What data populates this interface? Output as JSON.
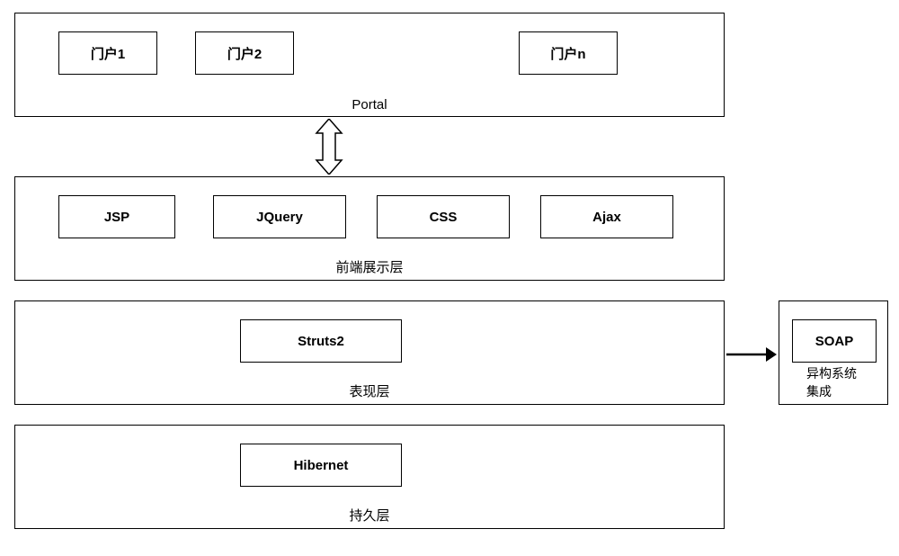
{
  "layers": {
    "portal": {
      "label": "Portal",
      "boxes": [
        "门户1",
        "门户2",
        "门户n"
      ]
    },
    "frontend": {
      "label": "前端展示层",
      "boxes": [
        "JSP",
        "JQuery",
        "CSS",
        "Ajax"
      ]
    },
    "presentation": {
      "label": "表现层",
      "boxes": [
        "Struts2"
      ]
    },
    "persistence": {
      "label": "持久层",
      "boxes": [
        "Hibernet"
      ]
    },
    "integration": {
      "label": "异构系统集成",
      "boxes": [
        "SOAP"
      ]
    }
  }
}
